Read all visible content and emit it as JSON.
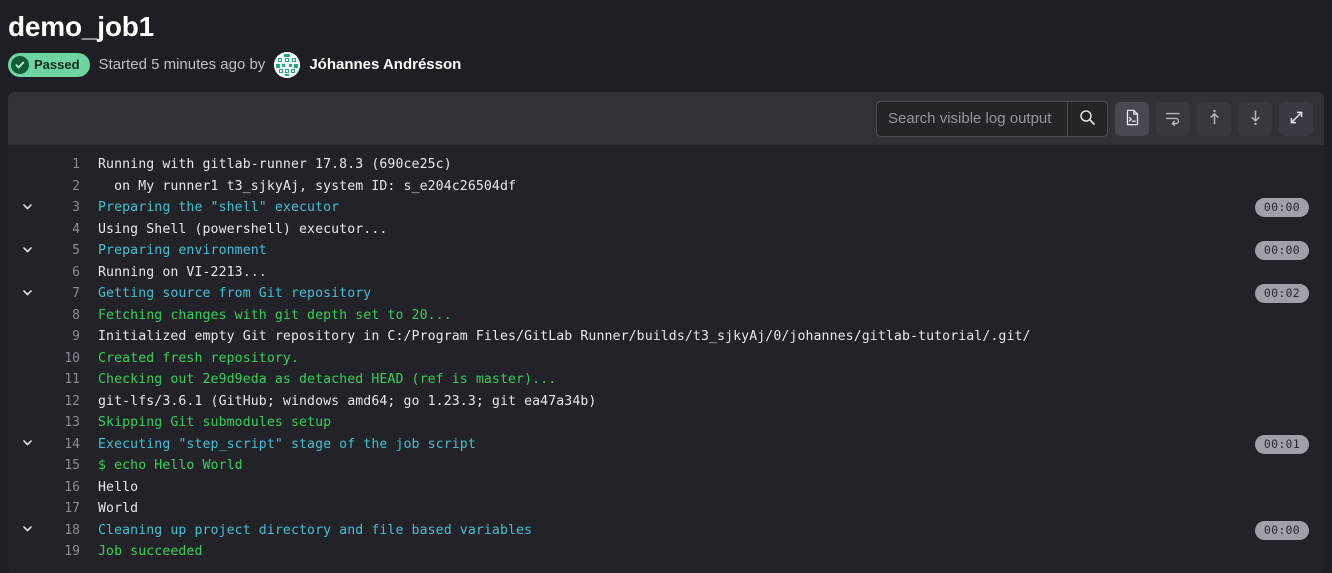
{
  "header": {
    "job_title": "demo_job1",
    "status_label": "Passed",
    "status_color": "#6dd4a2",
    "status_icon": "check-circle-icon",
    "started_text": "Started 5 minutes ago by",
    "user_name": "Jóhannes Andrésson"
  },
  "toolbar": {
    "search_placeholder": "Search visible log output",
    "search_value": "",
    "search_icon": "search-icon",
    "buttons": [
      {
        "name": "raw-log-button",
        "icon": "file-terminal-icon",
        "title": "Show complete raw"
      },
      {
        "name": "soft-wrap-button",
        "icon": "soft-wrap-icon",
        "title": "Soft wrap"
      },
      {
        "name": "scroll-to-top-button",
        "icon": "arrow-up-icon",
        "title": "Scroll to top"
      },
      {
        "name": "scroll-to-bottom-button",
        "icon": "arrow-down-icon",
        "title": "Scroll to bottom"
      },
      {
        "name": "full-screen-button",
        "icon": "expand-arrows-icon",
        "title": "Show full screen"
      }
    ]
  },
  "log": {
    "lines": [
      {
        "num": "1",
        "text": "Running with gitlab-runner 17.8.3 (690ce25c)",
        "style": "plain",
        "collapsible": false,
        "duration": ""
      },
      {
        "num": "2",
        "text": "  on My runner1 t3_sjkyAj, system ID: s_e204c26504df",
        "style": "plain",
        "collapsible": false,
        "duration": ""
      },
      {
        "num": "3",
        "text": "Preparing the \"shell\" executor",
        "style": "section",
        "collapsible": true,
        "duration": "00:00"
      },
      {
        "num": "4",
        "text": "Using Shell (powershell) executor...",
        "style": "plain",
        "collapsible": false,
        "duration": ""
      },
      {
        "num": "5",
        "text": "Preparing environment",
        "style": "section",
        "collapsible": true,
        "duration": "00:00"
      },
      {
        "num": "6",
        "text": "Running on VI-2213...",
        "style": "plain",
        "collapsible": false,
        "duration": ""
      },
      {
        "num": "7",
        "text": "Getting source from Git repository",
        "style": "section",
        "collapsible": true,
        "duration": "00:02"
      },
      {
        "num": "8",
        "text": "Fetching changes with git depth set to 20...",
        "style": "ok",
        "collapsible": false,
        "duration": ""
      },
      {
        "num": "9",
        "text": "Initialized empty Git repository in C:/Program Files/GitLab Runner/builds/t3_sjkyAj/0/johannes/gitlab-tutorial/.git/",
        "style": "plain",
        "collapsible": false,
        "duration": ""
      },
      {
        "num": "10",
        "text": "Created fresh repository.",
        "style": "ok",
        "collapsible": false,
        "duration": ""
      },
      {
        "num": "11",
        "text": "Checking out 2e9d9eda as detached HEAD (ref is master)...",
        "style": "ok",
        "collapsible": false,
        "duration": ""
      },
      {
        "num": "12",
        "text": "git-lfs/3.6.1 (GitHub; windows amd64; go 1.23.3; git ea47a34b)",
        "style": "plain",
        "collapsible": false,
        "duration": ""
      },
      {
        "num": "13",
        "text": "Skipping Git submodules setup",
        "style": "ok",
        "collapsible": false,
        "duration": ""
      },
      {
        "num": "14",
        "text": "Executing \"step_script\" stage of the job script",
        "style": "section",
        "collapsible": true,
        "duration": "00:01"
      },
      {
        "num": "15",
        "text": "$ echo Hello World",
        "style": "ok",
        "collapsible": false,
        "duration": ""
      },
      {
        "num": "16",
        "text": "Hello",
        "style": "plain",
        "collapsible": false,
        "duration": ""
      },
      {
        "num": "17",
        "text": "World",
        "style": "plain",
        "collapsible": false,
        "duration": ""
      },
      {
        "num": "18",
        "text": "Cleaning up project directory and file based variables",
        "style": "section",
        "collapsible": true,
        "duration": "00:00"
      },
      {
        "num": "19",
        "text": "Job succeeded",
        "style": "ok",
        "collapsible": false,
        "duration": ""
      }
    ]
  },
  "colors": {
    "section": "#41c0d4",
    "success": "#31d158",
    "plain": "#e8e8ea",
    "panel_bg": "#232229",
    "toolbar_bg": "#333138"
  }
}
